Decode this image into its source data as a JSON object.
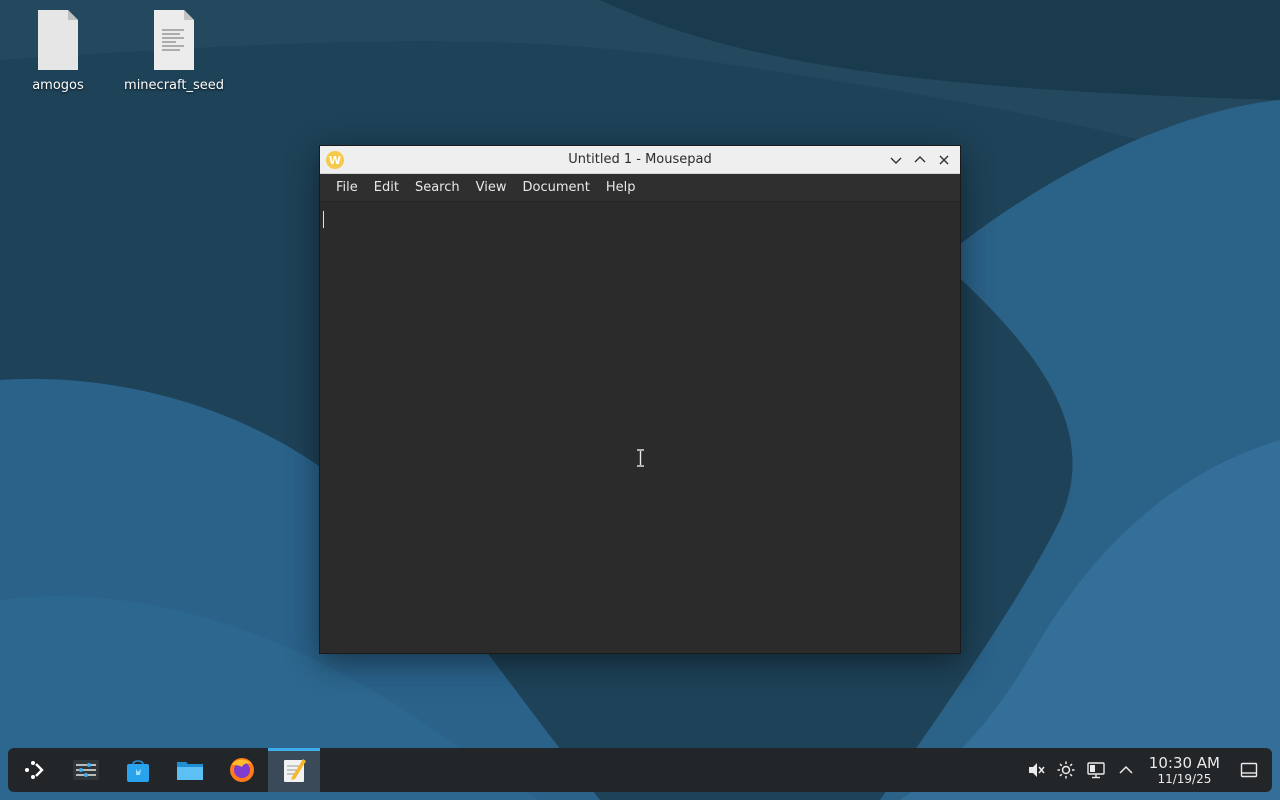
{
  "desktop": {
    "icons": [
      {
        "label": "amogos"
      },
      {
        "label": "minecraft_seed"
      }
    ]
  },
  "window": {
    "title": "Untitled 1 - Mousepad",
    "app_icon_glyph": "W",
    "menu": [
      "File",
      "Edit",
      "Search",
      "View",
      "Document",
      "Help"
    ],
    "editor_text": ""
  },
  "taskbar": {
    "apps": [
      {
        "name": "application-launcher-icon"
      },
      {
        "name": "system-settings-icon"
      },
      {
        "name": "discover-store-icon"
      },
      {
        "name": "file-manager-icon"
      },
      {
        "name": "firefox-icon"
      },
      {
        "name": "mousepad-icon",
        "active": true
      }
    ],
    "tray": {
      "time": "10:30 AM",
      "date": "11/19/25"
    }
  },
  "colors": {
    "accent": "#3daee9",
    "wallpaper_dark": "#1d4257",
    "wallpaper_light": "#2e6a8f",
    "taskbar": "#232629"
  }
}
